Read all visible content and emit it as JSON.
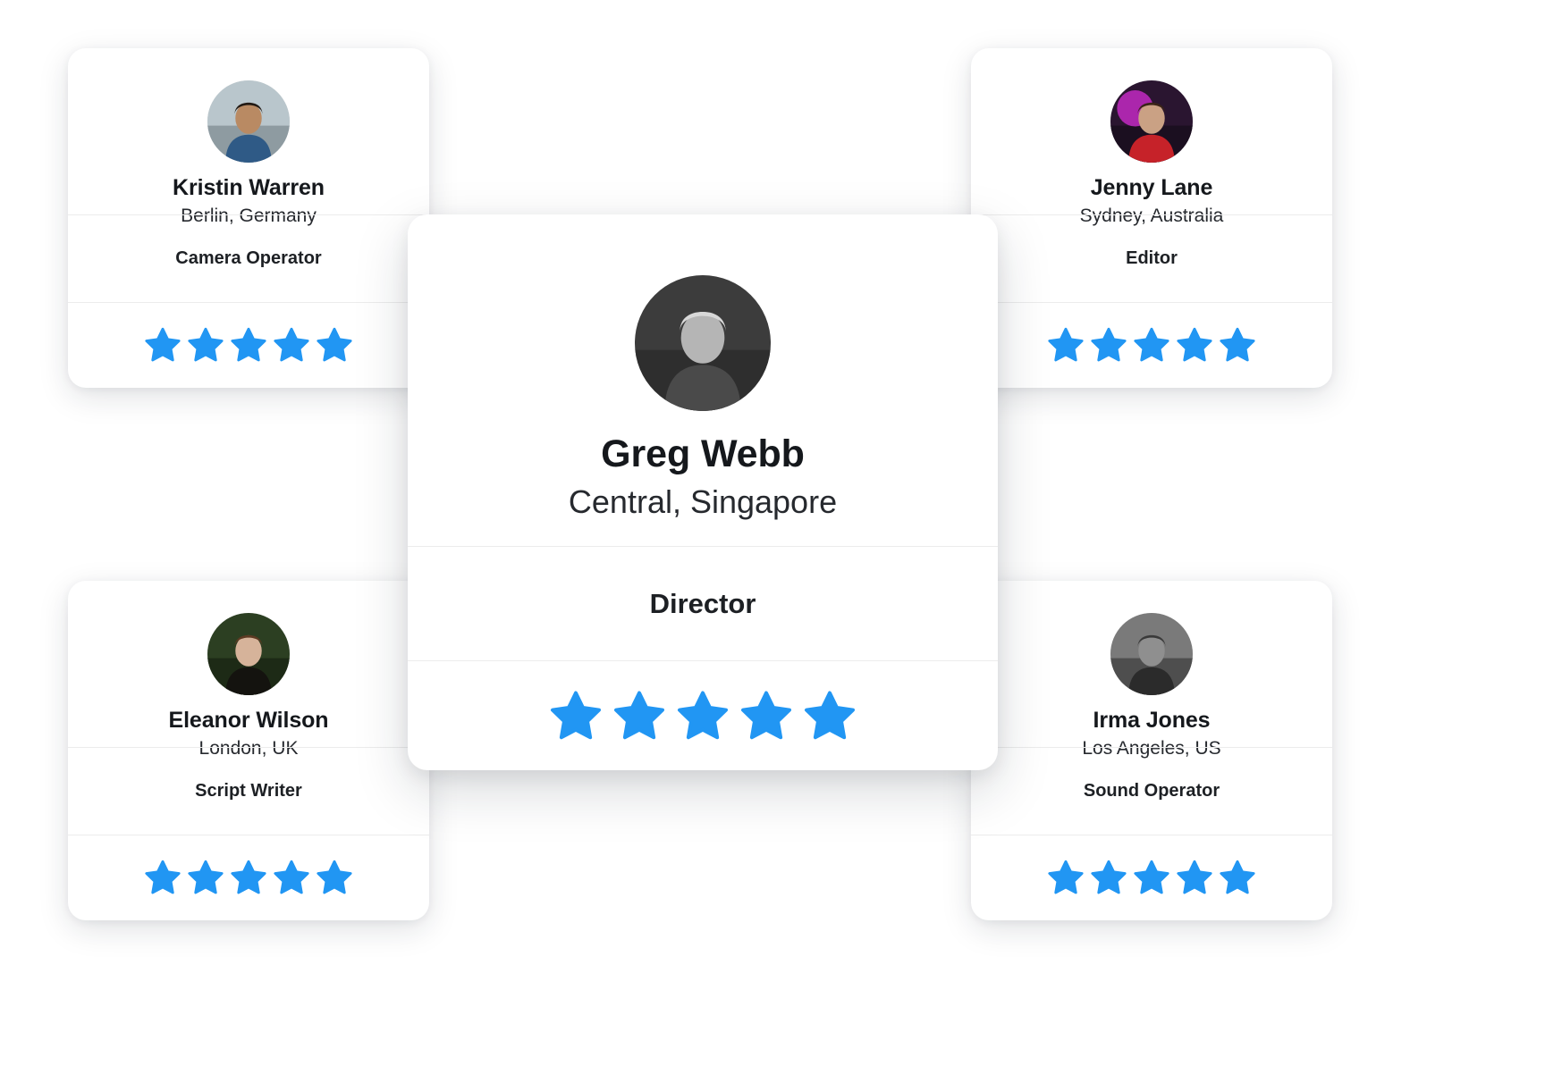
{
  "theme": {
    "background": "#ffffff",
    "card_background": "#ffffff",
    "star_color": "#2196f3",
    "divider_color": "#ececec",
    "name_color": "#15181c",
    "location_color": "#26292e"
  },
  "cards": [
    {
      "id": "kristin-warren",
      "name": "Kristin Warren",
      "location": "Berlin, Germany",
      "role": "Camera Operator",
      "rating": 5,
      "max_rating": 5,
      "avatar_alt": "Kristin Warren portrait",
      "featured": false,
      "position": "top-left"
    },
    {
      "id": "jenny-lane",
      "name": "Jenny Lane",
      "location": "Sydney, Australia",
      "role": "Editor",
      "rating": 5,
      "max_rating": 5,
      "avatar_alt": "Jenny Lane portrait",
      "featured": false,
      "position": "top-right"
    },
    {
      "id": "greg-webb",
      "name": "Greg Webb",
      "location": "Central, Singapore",
      "role": "Director",
      "rating": 5,
      "max_rating": 5,
      "avatar_alt": "Greg Webb portrait",
      "featured": true,
      "position": "center"
    },
    {
      "id": "eleanor-wilson",
      "name": "Eleanor Wilson",
      "location": "London, UK",
      "role": "Script Writer",
      "rating": 5,
      "max_rating": 5,
      "avatar_alt": "Eleanor Wilson portrait",
      "featured": false,
      "position": "bottom-left"
    },
    {
      "id": "irma-jones",
      "name": "Irma Jones",
      "location": "Los Angeles, US",
      "role": "Sound Operator",
      "rating": 5,
      "max_rating": 5,
      "avatar_alt": "Irma Jones portrait",
      "featured": false,
      "position": "bottom-right"
    }
  ]
}
